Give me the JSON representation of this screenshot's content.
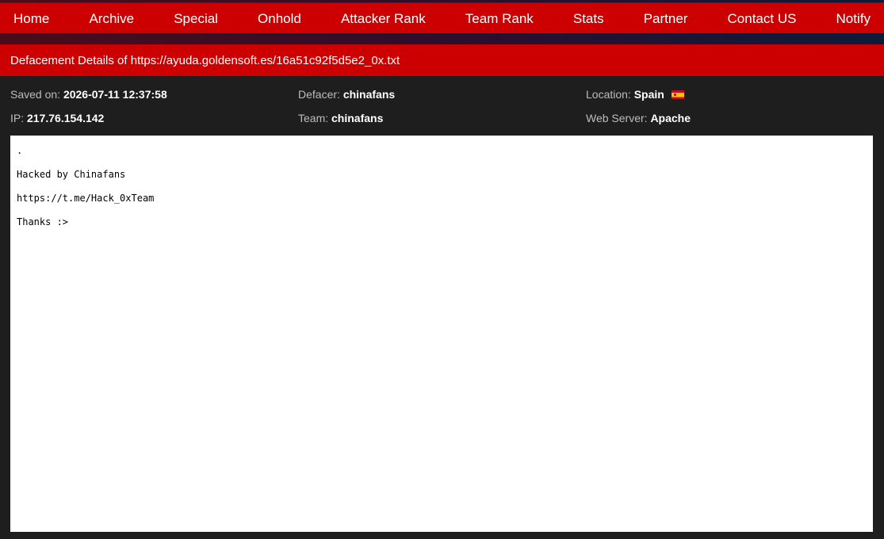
{
  "nav": {
    "items": [
      {
        "label": "Home"
      },
      {
        "label": "Archive"
      },
      {
        "label": "Special"
      },
      {
        "label": "Onhold"
      },
      {
        "label": "Attacker Rank"
      },
      {
        "label": "Team Rank"
      },
      {
        "label": "Stats"
      },
      {
        "label": "Partner"
      },
      {
        "label": "Contact US"
      },
      {
        "label": "Notify"
      }
    ]
  },
  "title": {
    "prefix": "Defacement Details of",
    "url": "https://ayuda.goldensoft.es/16a51c92f5d5e2_0x.txt"
  },
  "details": {
    "saved_label": "Saved on:",
    "saved_value": "2026-07-11 12:37:58",
    "defacer_label": "Defacer:",
    "defacer_value": "chinafans",
    "location_label": "Location:",
    "location_value": "Spain",
    "location_flag": "spain-flag-icon",
    "ip_label": "IP:",
    "ip_value": "217.76.154.142",
    "team_label": "Team:",
    "team_value": "chinafans",
    "server_label": "Web Server:",
    "server_value": "Apache"
  },
  "content": {
    "lines": [
      ".",
      "Hacked by Chinafans",
      "https://t.me/Hack_0xTeam",
      "Thanks :>"
    ]
  },
  "colors": {
    "nav_red": "#cc0000",
    "background": "#1e1e1e",
    "label_gray": "#bdbdbd"
  }
}
